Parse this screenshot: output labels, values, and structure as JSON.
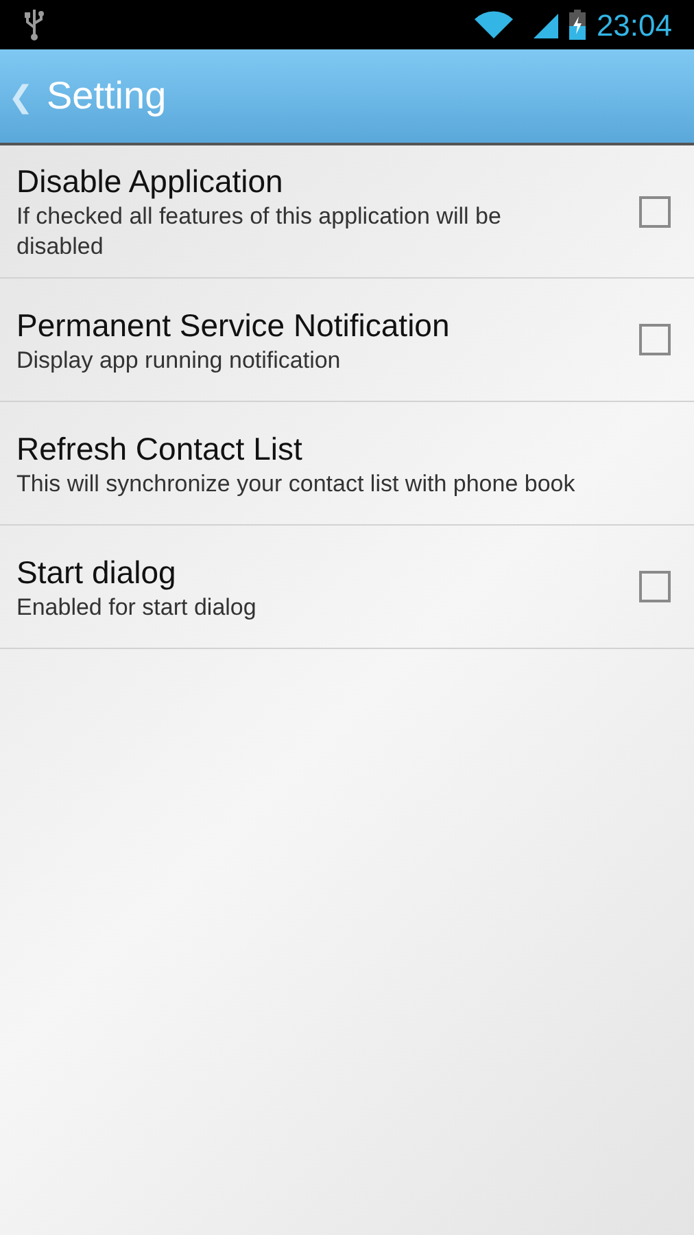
{
  "status_bar": {
    "time": "23:04"
  },
  "header": {
    "back": "❮",
    "title": "Setting"
  },
  "settings": [
    {
      "kind": "checkbox",
      "title": "Disable Application",
      "summary": "If checked all features of this application will be disabled",
      "checked": false
    },
    {
      "kind": "checkbox",
      "title": "Permanent Service Notification",
      "summary": "Display app running notification",
      "checked": false
    },
    {
      "kind": "plain",
      "title": "Refresh Contact List",
      "summary": "This will synchronize your contact list with phone book"
    },
    {
      "kind": "checkbox",
      "title": "Start dialog",
      "summary": "Enabled for start dialog",
      "checked": false
    }
  ]
}
